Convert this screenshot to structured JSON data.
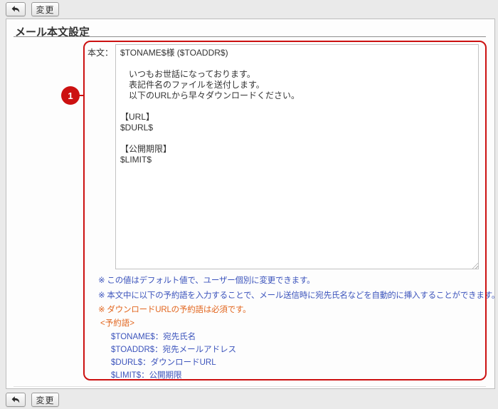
{
  "colors": {
    "annotation_red": "#cc1111",
    "note_blue": "#3c54bc",
    "note_orange": "#e2661f"
  },
  "toolbar": {
    "back_icon": "reply-arrow",
    "change_label": "変更"
  },
  "page": {
    "title": "メール本文設定"
  },
  "annotation": {
    "number": "1"
  },
  "form": {
    "body_label": "本文：",
    "body_value": "$TONAME$様 ($TOADDR$)\n\n　いつもお世話になっております。\n　表記件名のファイルを送付します。\n　以下のURLから早々ダウンロードください。\n\n【URL】\n$DURL$\n\n【公開期限】\n$LIMIT$"
  },
  "notes": {
    "lines": [
      {
        "text": "※ この値はデフォルト値で、ユーザー個別に変更できます。",
        "color": "blue"
      },
      {
        "text": "※ 本文中に以下の予約語を入力することで、メール送信時に宛先氏名などを自動的に挿入することができます。",
        "color": "blue"
      },
      {
        "text": "※ ダウンロードURLの予約語は必須です。",
        "color": "orange"
      }
    ],
    "reserved_header": "<予約語>",
    "reserved_words": [
      "$TONAME$：宛先氏名",
      "$TOADDR$：宛先メールアドレス",
      "$DURL$：ダウンロードURL",
      "$LIMIT$：公開期限"
    ]
  }
}
